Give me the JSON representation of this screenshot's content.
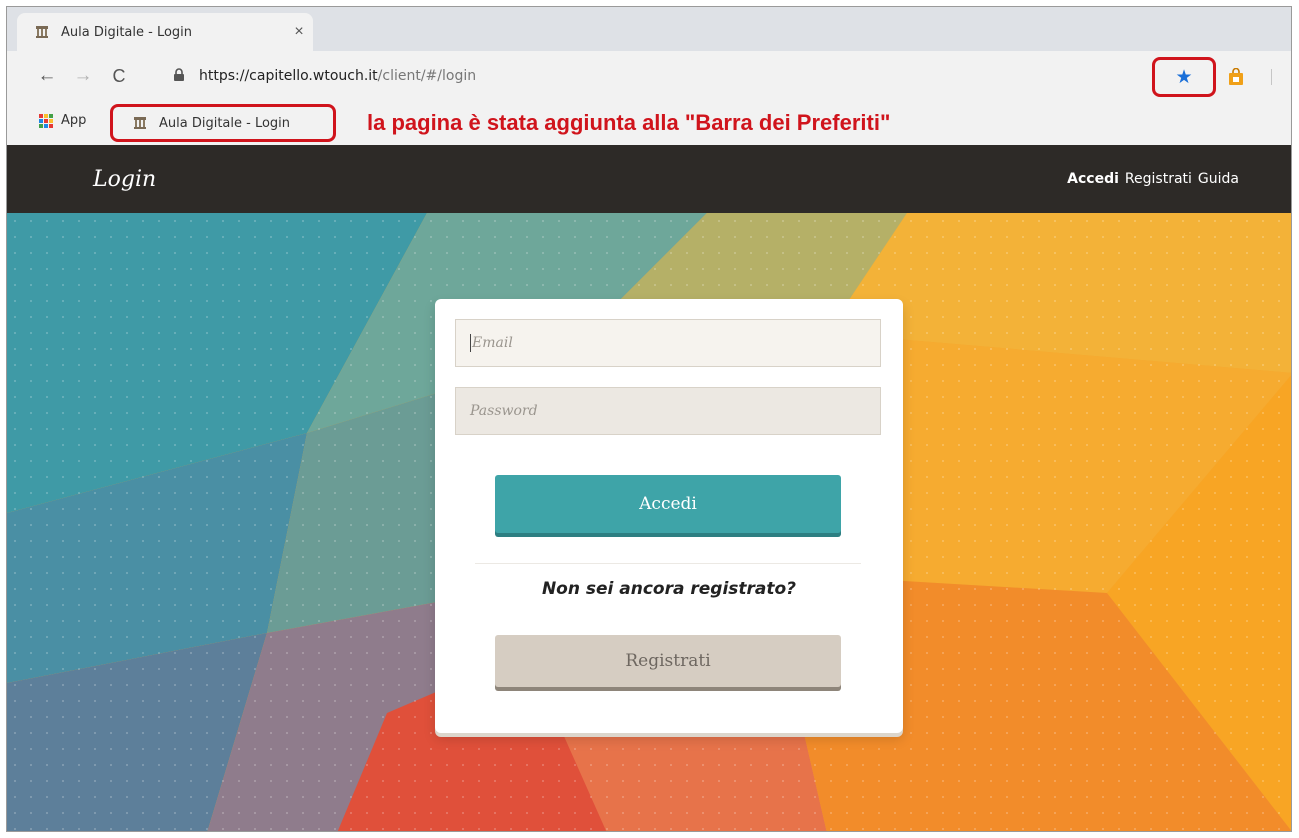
{
  "browser": {
    "tab": {
      "title": "Aula Digitale - Login",
      "close_label": "×"
    },
    "toolbar": {
      "back_label": "←",
      "forward_label": "→",
      "reload_label": "C",
      "url_main": "https://capitello.wtouch.it",
      "url_path": "/client/#/login",
      "star_icon": "★"
    },
    "bookmarks": {
      "apps_label": "App",
      "item_label": "Aula Digitale - Login"
    },
    "annotation": "la pagina è stata aggiunta alla \"Barra dei Preferiti\""
  },
  "site": {
    "title": "Login",
    "nav": [
      {
        "label": "Accedi"
      },
      {
        "label": "Registrati"
      },
      {
        "label": "Guida"
      }
    ]
  },
  "form": {
    "email_placeholder": "Email",
    "password_placeholder": "Password",
    "submit_label": "Accedi",
    "question": "Non sei ancora registrato?",
    "register_label": "Registrati"
  },
  "colors": {
    "highlight": "#d0141c",
    "primary_button": "#3ea4a8",
    "header": "#2d2a27",
    "bookmark_star": "#1a6fd8"
  }
}
